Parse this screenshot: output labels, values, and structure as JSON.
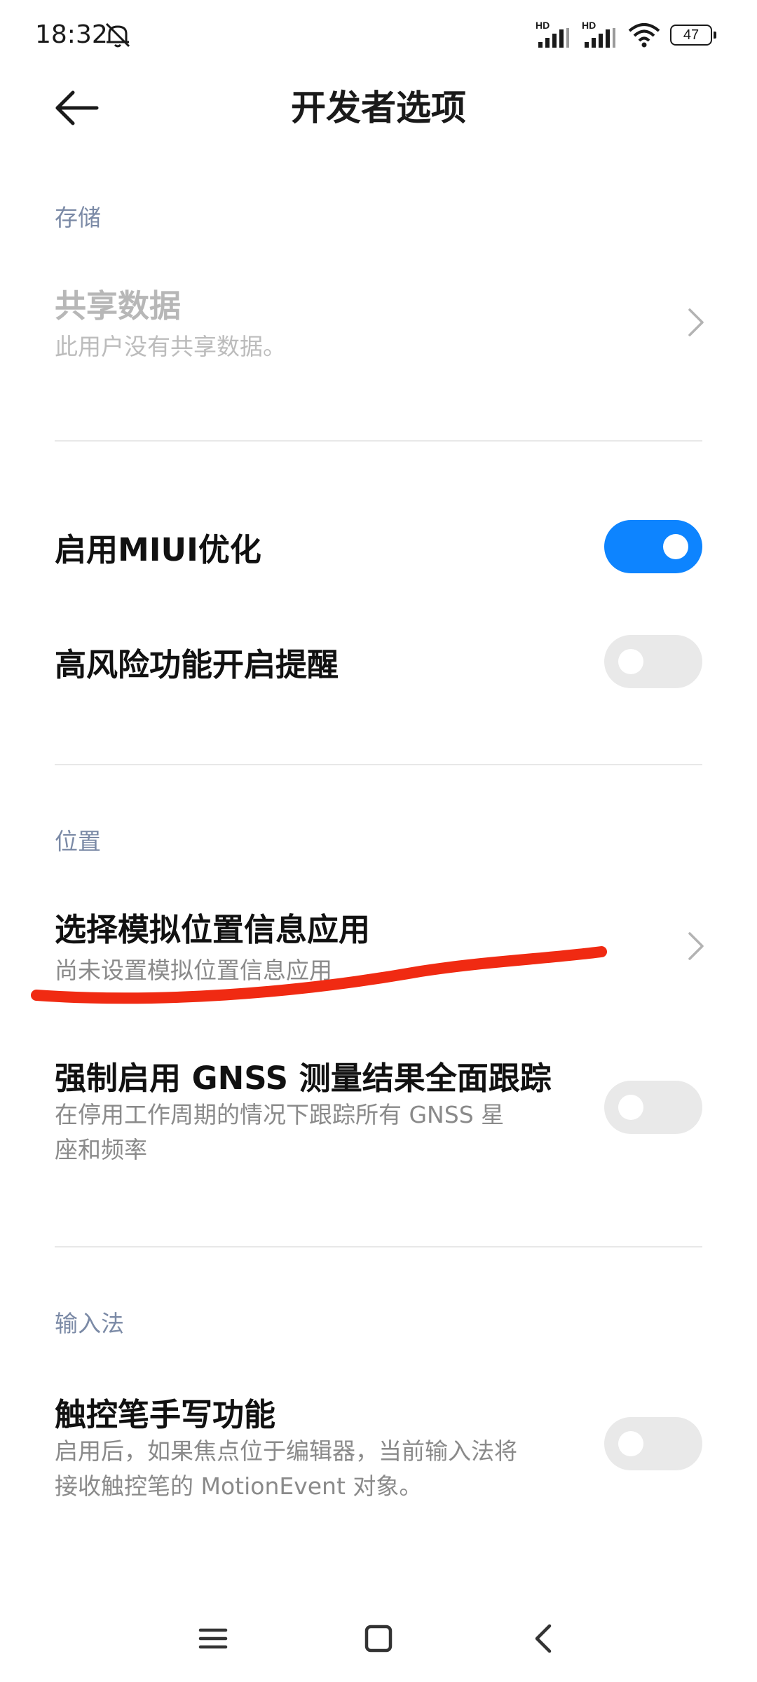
{
  "status_bar": {
    "time": "18:32",
    "signal1_badge": "HD",
    "signal2_badge": "HD",
    "battery_level": "47"
  },
  "header": {
    "title": "开发者选项"
  },
  "sections": {
    "storage": {
      "label": "存储",
      "shared_data": {
        "title": "共享数据",
        "subtitle": "此用户没有共享数据。"
      }
    },
    "miui": {
      "miui_opt": {
        "title": "启用MIUI优化",
        "enabled": true
      },
      "high_risk": {
        "title": "高风险功能开启提醒",
        "enabled": false
      }
    },
    "location": {
      "label": "位置",
      "mock_location": {
        "title": "选择模拟位置信息应用",
        "subtitle": "尚未设置模拟位置信息应用"
      },
      "gnss": {
        "title": "强制启用 GNSS 测量结果全面跟踪",
        "subtitle_line1": "在停用工作周期的情况下跟踪所有 GNSS 星",
        "subtitle_line2": "座和频率",
        "enabled": false
      }
    },
    "input": {
      "label": "输入法",
      "stylus": {
        "title": "触控笔手写功能",
        "subtitle_line1": "启用后，如果焦点位于编辑器，当前输入法将",
        "subtitle_line2": "接收触控笔的 MotionEvent 对象。",
        "enabled": false
      }
    }
  },
  "colors": {
    "accent": "#0d84ff",
    "annotation": "#f02a12"
  }
}
